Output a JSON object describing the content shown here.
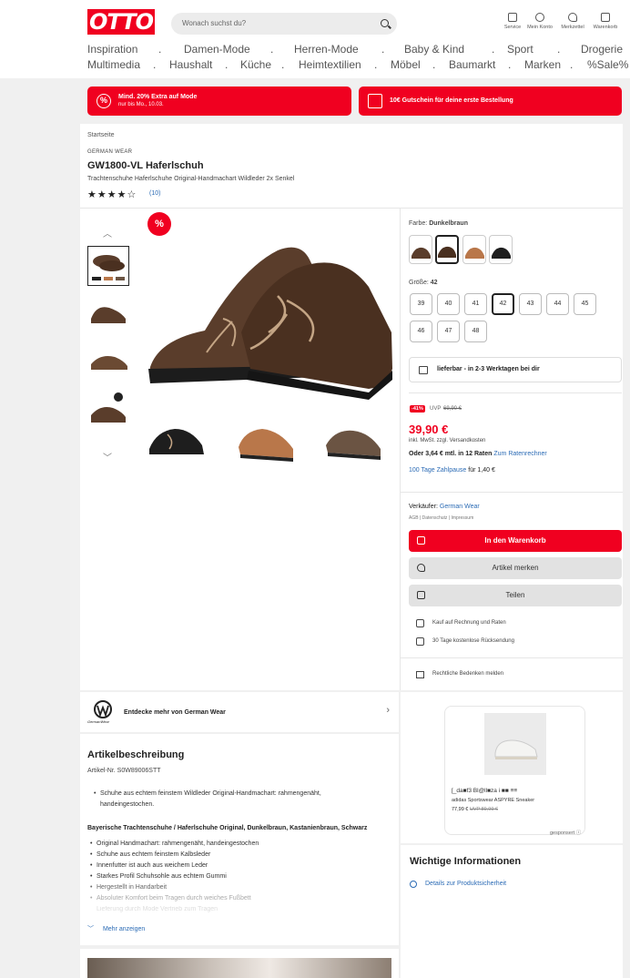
{
  "header": {
    "logo": "OTTO",
    "search_placeholder": "Wonach suchst du?",
    "icons": [
      {
        "label": "Service",
        "icon": "chat-icon"
      },
      {
        "label": "Mein Konto",
        "icon": "person-icon"
      },
      {
        "label": "Merkzettel",
        "icon": "heart-icon"
      },
      {
        "label": "Warenkorb",
        "icon": "cart-icon"
      }
    ],
    "nav_row1": [
      "Inspiration",
      ".",
      "Damen-Mode",
      ".",
      "Herren-Mode",
      ".",
      "Baby & Kind",
      ".",
      "Sport",
      ".",
      "Drogerie"
    ],
    "nav_row2": [
      "Multimedia",
      ".",
      "Haushalt",
      ".",
      "Küche",
      ".",
      "Heimtextilien",
      ".",
      "Möbel",
      ".",
      "Baumarkt",
      ".",
      "Marken",
      ".",
      "%Sale%"
    ]
  },
  "promos": [
    {
      "title": "Mind. 20% Extra auf Mode",
      "sub": "nur bis Mo., 10.03.",
      "icon": "percent-icon"
    },
    {
      "title": "10€ Gutschein für deine erste Bestellung",
      "sub": "",
      "icon": "gift-icon"
    }
  ],
  "product": {
    "breadcrumb": "Startseite",
    "brand": "GERMAN WEAR",
    "title": "GW1800-VL Haferlschuh",
    "subtitle": "Trachtenschuhe Haferlschuhe Original-Handmachart Wildleder 2x Senkel",
    "stars": "★★★★☆",
    "rating_count": "(10)",
    "sale_badge": "%",
    "color_label": "Farbe:",
    "color_value": "Dunkelbraun",
    "swatch_colors": [
      "#5a3d2b",
      "#4a3020",
      "#b9774a",
      "#1e1e1e"
    ],
    "size_label": "Größe:",
    "size_value": "42",
    "sizes": [
      "39",
      "40",
      "41",
      "42",
      "43",
      "44",
      "45",
      "46",
      "47",
      "48"
    ],
    "delivery": "lieferbar - in 2-3 Werktagen bei dir",
    "discount": "-41%",
    "uvp_label": "UVP",
    "uvp": "69,90 €",
    "price": "39,90 €",
    "price_note": "inkl. MwSt. zzgl. Versandkosten",
    "installment": "Oder 3,64 € mtl. in 12 Raten",
    "installment_link": "Zum Ratenrechner",
    "pay_later_link": "100 Tage Zahlpause",
    "pay_later_fee": "für 1,40 €",
    "seller_label": "Verkäufer:",
    "seller": "German Wear",
    "seller_links": "AGB | Datenschutz | Impressum",
    "cart_button": "In den Warenkorb",
    "wishlist_button": "Artikel merken",
    "share_button": "Teilen",
    "benefit1": "Kauf auf Rechnung und Raten",
    "benefit2": "30 Tage kostenlose Rücksendung",
    "report": "Rechtliche Bedenken melden"
  },
  "brand_banner": {
    "text": "Entdecke mehr von German Wear",
    "logo_text": "GermanWear"
  },
  "description": {
    "heading": "Artikelbeschreibung",
    "article_no": "Artikel-Nr. S0W89006STT",
    "bullet_intro": [
      "Schuhe aus echtem feinstem Wildleder Original-Handmachart: rahmengenäht,",
      "handeingestochen."
    ],
    "subheading": "Bayerische Trachtenschuhe / Haferlschuhe Original, Dunkelbraun, Kastanienbraun, Schwarz",
    "bullets": [
      "Original Handmachart: rahmengenäht, handeingestochen",
      "Schuhe aus echtem feinstem Kalbsleder",
      "Innenfutter ist auch aus weichem Leder",
      "Starkes Profil Schuhsohle aus echtem Gummi",
      "Hergestellt in Handarbeit",
      "Absoluter Komfort beim Tragen durch weiches Fußbett",
      "Lieferung durch Mode Vertrieb zum Tragen"
    ],
    "more": "Mehr anzeigen"
  },
  "ad": {
    "label_garbled": "[_da■f3 Bl@ll■za i ■■ ≡≡",
    "title": "adidas Sportswear ASPYRE Sneaker",
    "price": "77,99 €",
    "uvp": "UVP 89,99 €",
    "sponsored": "gesponsert ⓘ"
  },
  "info": {
    "heading": "Wichtige Informationen",
    "link": "Details zur Produktsicherheit"
  }
}
